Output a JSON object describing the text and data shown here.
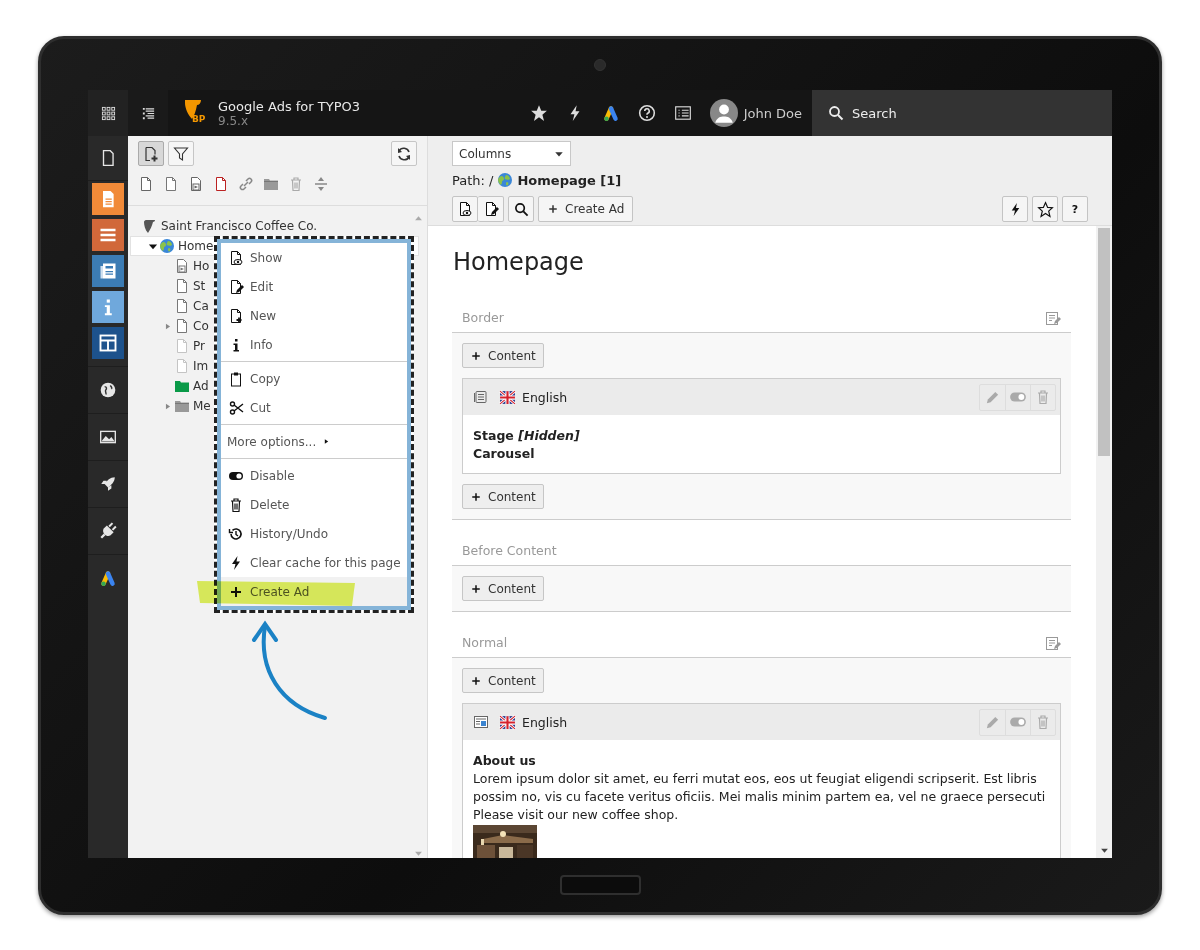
{
  "topbar": {
    "logo_text": "BP",
    "title": "Google Ads for TYPO3",
    "version": "9.5.x",
    "user": "John Doe",
    "search": "Search"
  },
  "page_tree": {
    "nodes": [
      {
        "label": "Saint Francisco Coffee Co.",
        "kind": "site",
        "selected": false,
        "children": [
          {
            "label": "Home",
            "kind": "globe",
            "expanded": true,
            "selected": true,
            "children": [
              {
                "label": "Ho",
                "kind": "shortcut",
                "selected": false
              },
              {
                "label": "St",
                "kind": "page",
                "selected": false
              },
              {
                "label": "Ca",
                "kind": "page",
                "selected": false
              },
              {
                "label": "Co",
                "kind": "page",
                "expanded": false,
                "selected": false
              },
              {
                "label": "Pr",
                "kind": "page-hidden",
                "selected": false
              },
              {
                "label": "Im",
                "kind": "page-hidden",
                "selected": false
              },
              {
                "label": "Ad",
                "kind": "folder-green",
                "selected": false
              },
              {
                "label": "Me",
                "kind": "folder-grey",
                "expanded": false,
                "selected": false
              }
            ]
          }
        ]
      }
    ]
  },
  "context_menu": {
    "groups": [
      {
        "items": [
          {
            "label": "Show",
            "kind": "action",
            "highlighted": false
          },
          {
            "label": "Edit",
            "kind": "action",
            "highlighted": false
          },
          {
            "label": "New",
            "kind": "action",
            "highlighted": false
          },
          {
            "label": "Info",
            "kind": "action",
            "highlighted": false
          }
        ]
      },
      {
        "items": [
          {
            "label": "Copy",
            "kind": "action",
            "highlighted": false
          },
          {
            "label": "Cut",
            "kind": "action",
            "highlighted": false
          }
        ]
      },
      {
        "items": [
          {
            "label": "More options...",
            "kind": "submenu",
            "highlighted": false
          }
        ]
      },
      {
        "items": [
          {
            "label": "Disable",
            "kind": "action",
            "highlighted": false
          },
          {
            "label": "Delete",
            "kind": "action",
            "highlighted": false
          },
          {
            "label": "History/Undo",
            "kind": "action",
            "highlighted": false
          },
          {
            "label": "Clear cache for this page",
            "kind": "action",
            "highlighted": false
          },
          {
            "label": "Create Ad",
            "kind": "action",
            "highlighted": true
          }
        ]
      }
    ]
  },
  "docheader": {
    "view_select": "Columns",
    "path_label": "Path: /",
    "path_page": "Homepage [1]",
    "create_button": "Create Ad",
    "help_button": "?"
  },
  "content": {
    "title": "Homepage",
    "sections": [
      {
        "name": "Border",
        "editable": true,
        "rows": [
          {
            "kind": "add",
            "label": "Content"
          },
          {
            "kind": "text-element",
            "language": "English",
            "lines": [
              {
                "text": "Stage *[Hidden]*",
                "bold": true
              },
              {
                "text": "Carousel",
                "bold": true
              }
            ]
          },
          {
            "kind": "add",
            "label": "Content"
          }
        ]
      },
      {
        "name": "Before Content",
        "editable": false,
        "rows": [
          {
            "kind": "add",
            "label": "Content"
          }
        ]
      },
      {
        "name": "Normal",
        "editable": true,
        "rows": [
          {
            "kind": "add",
            "label": "Content"
          },
          {
            "kind": "textmedia-element",
            "language": "English",
            "lines": [
              {
                "text": "About us",
                "bold": true
              },
              {
                "text": "Lorem ipsum dolor sit amet, eu ferri mutat eos, eos ut feugiat eligendi scripserit. Est libris",
                "bold": false
              },
              {
                "text": "possim no, vis cu facete veritus oficiis. Mei malis minim partem ea, vel ne graece persecuti",
                "bold": false
              },
              {
                "text": "Please visit our new coffee shop.",
                "bold": false
              }
            ],
            "media": {
              "kind": "picture"
            }
          }
        ]
      }
    ]
  }
}
